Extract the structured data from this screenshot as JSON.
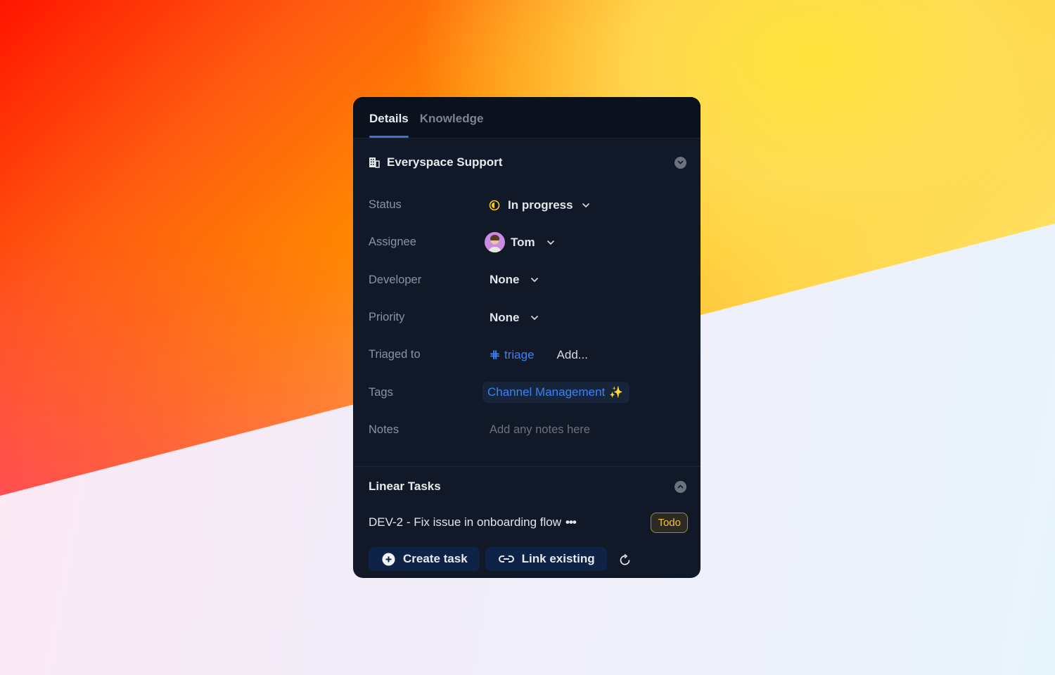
{
  "tabs": [
    {
      "label": "Details",
      "active": true
    },
    {
      "label": "Knowledge",
      "active": false
    }
  ],
  "details_section": {
    "title": "Everyspace Support",
    "icon": "building-icon",
    "collapse_icon": "chevron-down-circle-icon"
  },
  "fields": {
    "status": {
      "label": "Status",
      "value": "In progress",
      "icon": "half-circle-status-icon",
      "color": "#facc15"
    },
    "assignee": {
      "label": "Assignee",
      "value": "Tom",
      "icon": "avatar"
    },
    "developer": {
      "label": "Developer",
      "value": "None"
    },
    "priority": {
      "label": "Priority",
      "value": "None"
    },
    "triaged_to": {
      "label": "Triaged to",
      "channel": "triage",
      "channel_icon": "slack-icon",
      "add_label": "Add..."
    },
    "tags": {
      "label": "Tags",
      "items": [
        {
          "label": "Channel Management",
          "icon": "sparkles-icon"
        }
      ]
    },
    "notes": {
      "label": "Notes",
      "placeholder": "Add any notes here",
      "value": ""
    }
  },
  "linear_section": {
    "title": "Linear Tasks",
    "collapse_icon": "chevron-up-circle-icon",
    "tasks": [
      {
        "title": "DEV-2 - Fix issue in onboarding flow",
        "more": "•••",
        "status": "Todo"
      }
    ],
    "actions": {
      "create_label": "Create task",
      "link_label": "Link existing",
      "refresh_icon": "refresh-icon"
    }
  },
  "colors": {
    "panel_bg": "#111827",
    "accent": "#3b82f6",
    "status_yellow": "#facc15",
    "todo_border": "#a38a2e",
    "button_bg": "#0f2347"
  }
}
